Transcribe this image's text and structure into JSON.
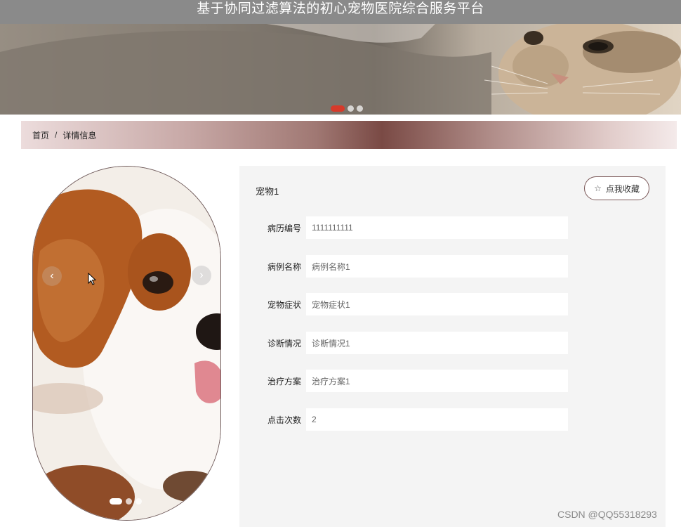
{
  "header": {
    "title": "基于协同过滤算法的初心宠物医院综合服务平台"
  },
  "banner": {
    "image": "cat-photo",
    "active_dot": 0,
    "dot_count": 3,
    "active_color": "#d63a2a"
  },
  "breadcrumb": {
    "home": "首页",
    "separator": "/",
    "current": "详情信息"
  },
  "gallery": {
    "image": "puppy-photo",
    "prev_icon": "‹",
    "next_icon": "›",
    "dot_count": 3,
    "active_dot": 0
  },
  "detail": {
    "title": "宠物1",
    "favorite_label": "点我收藏",
    "favorite_icon": "☆",
    "fields": [
      {
        "label": "病历编号",
        "value": "1111111111"
      },
      {
        "label": "病例名称",
        "value": "病例名称1"
      },
      {
        "label": "宠物症状",
        "value": "宠物症状1"
      },
      {
        "label": "诊断情况",
        "value": "诊断情况1"
      },
      {
        "label": "治疗方案",
        "value": "治疗方案1"
      },
      {
        "label": "点击次数",
        "value": "2"
      }
    ]
  },
  "watermark": "CSDN @QQ55318293"
}
